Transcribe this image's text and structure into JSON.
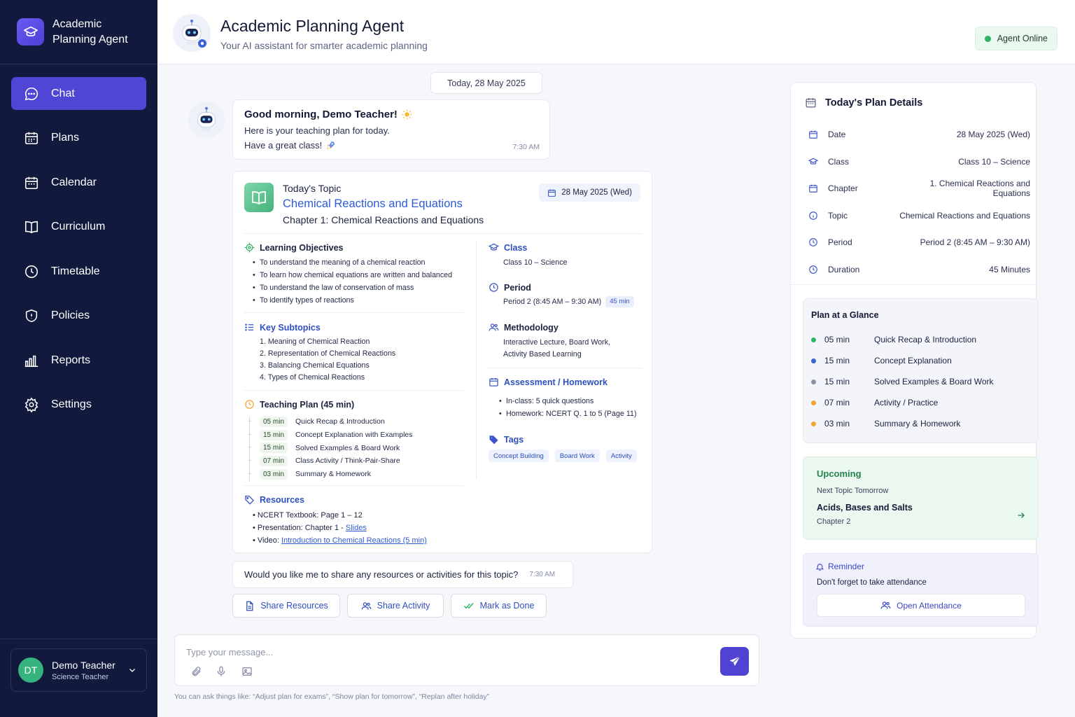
{
  "app": {
    "brand": "Academic Planning Agent"
  },
  "sidebar": {
    "items": [
      {
        "label": "Chat",
        "icon": "chat-icon",
        "active": true
      },
      {
        "label": "Plans",
        "icon": "calendar-icon"
      },
      {
        "label": "Calendar",
        "icon": "calendar-icon"
      },
      {
        "label": "Curriculum",
        "icon": "book-icon"
      },
      {
        "label": "Timetable",
        "icon": "clock-icon"
      },
      {
        "label": "Policies",
        "icon": "shield-icon"
      },
      {
        "label": "Reports",
        "icon": "bar-chart-icon"
      },
      {
        "label": "Settings",
        "icon": "gear-icon"
      }
    ],
    "user": {
      "initials": "DT",
      "name": "Demo Teacher",
      "role": "Science Teacher"
    }
  },
  "header": {
    "title": "Academic Planning Agent",
    "subtitle": "Your AI assistant for smarter academic planning",
    "status": "Agent Online"
  },
  "chat": {
    "date": "Today, 28 May 2025",
    "greeting": {
      "title": "Good morning, Demo Teacher!",
      "line1": "Here is your teaching plan for today.",
      "line2": "Have a great class!",
      "time": "7:30 AM"
    },
    "plan": {
      "label": "Today's Topic",
      "topic": "Chemical Reactions and Equations",
      "chapter": "Chapter 1: Chemical Reactions and Equations",
      "date": "28 May 2025 (Wed)",
      "objectives_title": "Learning Objectives",
      "objectives": [
        "To understand the meaning of a chemical reaction",
        "To learn how chemical equations are written and balanced",
        "To understand the law of conservation of mass",
        "To identify types of reactions"
      ],
      "subtopics_title": "Key Subtopics",
      "subtopics": [
        "1. Meaning of Chemical Reaction",
        "2. Representation of Chemical Reactions",
        "3. Balancing Chemical Equations",
        "4. Types of Chemical Reactions"
      ],
      "teaching_title": "Teaching Plan (45 min)",
      "teaching": [
        {
          "min": "05 min",
          "text": "Quick Recap & Introduction"
        },
        {
          "min": "15 min",
          "text": "Concept Explanation with Examples"
        },
        {
          "min": "15 min",
          "text": "Solved Examples & Board Work"
        },
        {
          "min": "07 min",
          "text": "Class Activity / Think-Pair-Share"
        },
        {
          "min": "03 min",
          "text": "Summary & Homework"
        }
      ],
      "resources_title": "Resources",
      "resources": {
        "r1": "NCERT Textbook: Page 1 – 12",
        "r2_prefix": "Presentation: Chapter 1 - ",
        "r2_link": "Slides",
        "r3_prefix": "Video: ",
        "r3_link": "Introduction to Chemical Reactions (5 min)"
      },
      "class_title": "Class",
      "class_value": "Class 10 – Science",
      "period_title": "Period",
      "period_value": "Period 2 (8:45 AM – 9:30 AM)",
      "period_badge": "45 min",
      "method_title": "Methodology",
      "method_line1": "Interactive Lecture, Board Work,",
      "method_line2": "Activity Based Learning",
      "assess_title": "Assessment / Homework",
      "assess": [
        "In-class: 5 quick questions",
        "Homework: NCERT Q. 1 to 5 (Page 11)"
      ],
      "tags_title": "Tags",
      "tags": [
        "Concept Building",
        "Board Work",
        "Activity"
      ]
    },
    "question": {
      "text": "Would you like me to share any resources or activities for this topic?",
      "time": "7:30 AM"
    },
    "actions": [
      "Share Resources",
      "Share Activity",
      "Mark as Done"
    ],
    "composer_placeholder": "Type your message...",
    "hint": "You can ask things like: “Adjust plan for exams”, “Show plan for tomorrow”, “Replan after holiday”"
  },
  "panel": {
    "title": "Today's Plan Details",
    "details": [
      {
        "label": "Date",
        "value": "28 May 2025 (Wed)"
      },
      {
        "label": "Class",
        "value": "Class 10 – Science"
      },
      {
        "label": "Chapter",
        "value": "1. Chemical Reactions and Equations"
      },
      {
        "label": "Topic",
        "value": "Chemical Reactions and Equations"
      },
      {
        "label": "Period",
        "value": "Period 2 (8:45 AM – 9:30 AM)"
      },
      {
        "label": "Duration",
        "value": "45 Minutes"
      }
    ],
    "glance_title": "Plan at a Glance",
    "glance": [
      {
        "min": "05 min",
        "text": "Quick Recap & Introduction",
        "color": "#2fb463"
      },
      {
        "min": "15 min",
        "text": "Concept Explanation",
        "color": "#3b63d6"
      },
      {
        "min": "15 min",
        "text": "Solved Examples & Board Work",
        "color": "#8a94a6"
      },
      {
        "min": "07 min",
        "text": "Activity / Practice",
        "color": "#f2a52c"
      },
      {
        "min": "03 min",
        "text": "Summary & Homework",
        "color": "#f2a52c"
      }
    ],
    "upcoming": {
      "title": "Upcoming",
      "sub": "Next Topic Tomorrow",
      "name": "Acids, Bases and Salts",
      "chapter": "Chapter 2"
    },
    "reminder": {
      "title": "Reminder",
      "text": "Don't forget to take attendance",
      "button": "Open Attendance"
    }
  },
  "colors": {
    "sidebar": "#111a3c",
    "accent": "#4f46d6",
    "link": "#2e5bd6",
    "online": "#2fb463"
  }
}
